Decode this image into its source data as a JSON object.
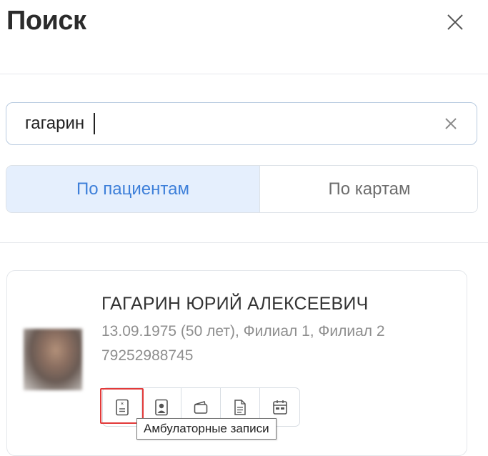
{
  "header": {
    "title": "Поиск",
    "close_icon": "close-icon"
  },
  "search": {
    "value": "гагарин",
    "placeholder": "",
    "clear_icon": "clear-icon"
  },
  "tabs": [
    {
      "label": "По пациентам",
      "active": true
    },
    {
      "label": "По картам",
      "active": false
    }
  ],
  "result": {
    "name": "ГАГАРИН ЮРИЙ АЛЕКСЕЕВИЧ",
    "meta": "13.09.1975 (50 лет), Филиал 1, Филиал 2",
    "phone": "79252988745",
    "actions": [
      {
        "icon": "ambulatory-record-icon",
        "tooltip": "Амбулаторные записи"
      },
      {
        "icon": "patient-card-icon"
      },
      {
        "icon": "wallet-icon"
      },
      {
        "icon": "document-icon"
      },
      {
        "icon": "calendar-icon"
      }
    ]
  },
  "tooltip": {
    "text": "Амбулаторные записи"
  },
  "colors": {
    "accent": "#3d7fd9",
    "active_tab_bg": "#e5effd",
    "highlight": "#e23a3a",
    "muted_text": "#8e8e8e"
  }
}
